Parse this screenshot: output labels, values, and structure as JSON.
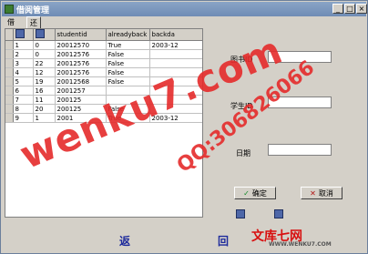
{
  "window": {
    "title": "借阅管理"
  },
  "tabs": [
    {
      "label": "借书"
    },
    {
      "label": "还书"
    }
  ],
  "grid": {
    "headers": [
      "",
      "",
      "studentid",
      "alreadyback",
      "backda"
    ],
    "rows": [
      {
        "id": "1",
        "book": "0",
        "student": "20012570",
        "back": "True",
        "date": "2003-12"
      },
      {
        "id": "2",
        "book": "0",
        "student": "20012576",
        "back": "False",
        "date": ""
      },
      {
        "id": "3",
        "book": "22",
        "student": "20012576",
        "back": "False",
        "date": ""
      },
      {
        "id": "4",
        "book": "12",
        "student": "20012576",
        "back": "False",
        "date": ""
      },
      {
        "id": "5",
        "book": "19",
        "student": "20012568",
        "back": "False",
        "date": ""
      },
      {
        "id": "6",
        "book": "16",
        "student": "2001257",
        "back": "",
        "date": ""
      },
      {
        "id": "7",
        "book": "11",
        "student": "200125",
        "back": "",
        "date": ""
      },
      {
        "id": "8",
        "book": "20",
        "student": "200125",
        "back": "False",
        "date": ""
      },
      {
        "id": "9",
        "book": "1",
        "student": "2001",
        "back": "True",
        "date": "2003-12"
      }
    ]
  },
  "form": {
    "book_label": "图书ID",
    "student_label": "学生ID",
    "date_label": "日期"
  },
  "buttons": {
    "confirm": "确定",
    "cancel": "取消",
    "return_a": "返",
    "return_b": "回"
  },
  "watermark": {
    "main": "wenku7.com",
    "qq": "QQ:306826066",
    "brand": "文库七网",
    "url": "WWW.WENKU7.COM"
  },
  "colors": {
    "watermark": "#e52b2b",
    "title": "#6f8cb5"
  }
}
